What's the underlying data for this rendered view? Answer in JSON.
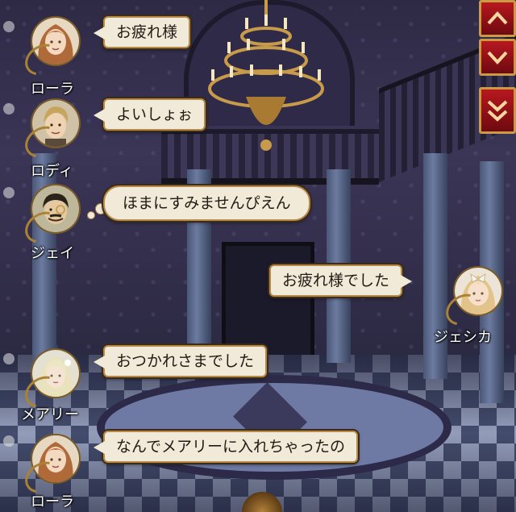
{
  "menu": {
    "buttons": [
      {
        "icon": "chevron-up-icon"
      },
      {
        "icon": "chevron-down-icon"
      },
      {
        "icon": "double-chevron-down-icon"
      }
    ]
  },
  "messages": [
    {
      "name": "ローラ",
      "text": "お疲れ様",
      "side": "left"
    },
    {
      "name": "ロディ",
      "text": "よいしょぉ",
      "side": "left"
    },
    {
      "name": "ジェイ",
      "text": "ほまにすみませんぴえん",
      "side": "left",
      "thought": true
    },
    {
      "name": "ジェシカ",
      "text": "お疲れ様でした",
      "side": "right"
    },
    {
      "name": "メアリー",
      "text": "おつかれさまでした",
      "side": "left"
    },
    {
      "name": "ローラ",
      "text": "なんでメアリーに入れちゃったの",
      "side": "left"
    }
  ],
  "colors": {
    "bubble": "#f1ead9",
    "bubble_border": "#b48a4c",
    "menu_red": "#b8171f",
    "gold": "#c99b45"
  }
}
